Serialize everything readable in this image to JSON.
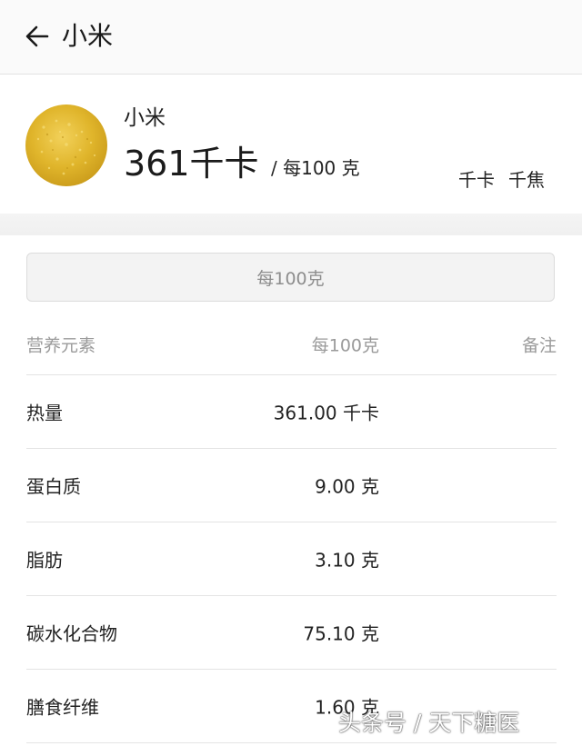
{
  "appbar": {
    "back_icon": "arrow-left-icon",
    "title": "小米"
  },
  "food": {
    "name": "小米",
    "energy": "361千卡",
    "per_label": "/ 每100 克",
    "image_color": "#e0b52b"
  },
  "unit_tabs": [
    {
      "label": "千卡",
      "active": true
    },
    {
      "label": "千焦",
      "active": false
    }
  ],
  "per_button_label": "每100克",
  "table": {
    "headers": {
      "name": "营养元素",
      "value": "每100克",
      "note": "备注"
    },
    "rows": [
      {
        "name": "热量",
        "value": "361.00 千卡",
        "note": ""
      },
      {
        "name": "蛋白质",
        "value": "9.00 克",
        "note": ""
      },
      {
        "name": "脂肪",
        "value": "3.10 克",
        "note": ""
      },
      {
        "name": "碳水化合物",
        "value": "75.10 克",
        "note": ""
      },
      {
        "name": "膳食纤维",
        "value": "1.60 克",
        "note": ""
      }
    ]
  },
  "watermark": "头条号 / 天下糖医",
  "colors": {
    "accent_underline": "#e07a63"
  }
}
